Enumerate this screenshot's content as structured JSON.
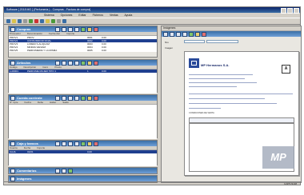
{
  "window": {
    "title": "Software [ 2018 MG ] (Perfumeria ) - Compras - Factura de compra]"
  },
  "menu": {
    "items": [
      "Sistema",
      "Opciones",
      "Editar",
      "Ficheros",
      "Ventas",
      "Ayuda"
    ]
  },
  "panels": {
    "compras": {
      "title": "Compras",
      "columns": [
        "Proveedor",
        "Denominación",
        "Fecha doc",
        "Importe"
      ],
      "rows": [
        [
          "PROV1",
          "PROV.",
          "0001",
          "0.00"
        ],
        [
          "PROV2",
          "CONSUMIDOR FINAL",
          "0002",
          "0.00"
        ],
        [
          "PROV3",
          "LOREM S.ALIQUAM",
          "0003",
          "0.00"
        ],
        [
          "PROV4",
          "MINIMA VENIAM",
          "0004",
          "0.00"
        ],
        [
          "PROV5",
          "PERFUMERIA Y LA MISMA",
          "0005",
          "0.00"
        ]
      ]
    },
    "articulos": {
      "title": "Artículos",
      "columns": [
        "Código",
        "Descripción",
        "Cant.",
        "Precio"
      ],
      "rows": [
        [
          "1-00001",
          "PERFUME MUJER TIPO 1",
          "1",
          "0.00"
        ]
      ]
    },
    "cuenta": {
      "title": "Cuenta corriente",
      "columns": [
        "N° Cpte",
        "Fecha",
        "Debe",
        "Haber",
        "Saldo"
      ]
    },
    "caja": {
      "title": "Caja y bancos",
      "columns": [
        "Cuenta",
        "Fecha",
        "Importe"
      ],
      "rows": [
        [
          "CAJA",
          "01/01",
          "0.00"
        ]
      ]
    },
    "comentarios": {
      "title": "Comentarios"
    },
    "imagenes": {
      "title": "Imágenes"
    }
  },
  "right": {
    "title": "Imágenes",
    "field_label_1": "Nro",
    "field_label_2": "Imagen",
    "doc": {
      "company": "MP Hermanos S.A.",
      "letter": "A",
      "label_a": "CONDICIONES DE VENTA",
      "watermark": "MP"
    }
  },
  "status": {
    "text": "CAPS NUM"
  }
}
